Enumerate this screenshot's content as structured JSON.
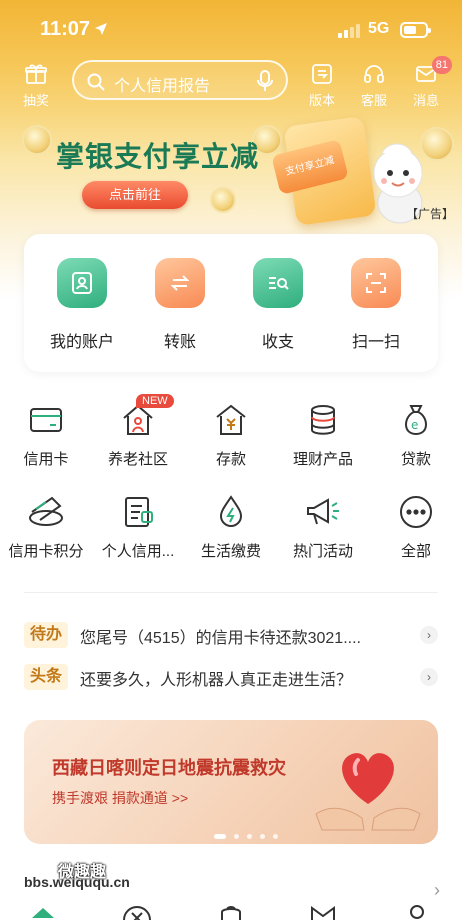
{
  "status_bar": {
    "time": "11:07",
    "network": "5G"
  },
  "header": {
    "left_button": {
      "label": "抽奖",
      "icon": "gift-icon"
    },
    "search_placeholder": "个人信用报告",
    "right_buttons": [
      {
        "label": "版本",
        "icon": "version-icon"
      },
      {
        "label": "客服",
        "icon": "headset-icon"
      },
      {
        "label": "消息",
        "icon": "mail-icon",
        "badge": "81"
      }
    ]
  },
  "banner": {
    "title": "掌银支付享立减",
    "button_label": "点击前往",
    "card_text": "支付享立减",
    "ad_label": "【广告】"
  },
  "quick_actions": [
    {
      "label": "我的账户",
      "icon": "account-icon",
      "color": "#2fae7e"
    },
    {
      "label": "转账",
      "icon": "transfer-icon",
      "color": "#f88a54"
    },
    {
      "label": "收支",
      "icon": "ledger-search-icon",
      "color": "#2fae7e"
    },
    {
      "label": "扫一扫",
      "icon": "scan-icon",
      "color": "#f88a54"
    }
  ],
  "services": [
    {
      "label": "信用卡",
      "icon": "credit-card-icon"
    },
    {
      "label": "养老社区",
      "icon": "elderly-community-icon",
      "tag": "NEW"
    },
    {
      "label": "存款",
      "icon": "deposit-icon"
    },
    {
      "label": "理财产品",
      "icon": "wealth-products-icon"
    },
    {
      "label": "贷款",
      "icon": "loan-icon"
    },
    {
      "label": "信用卡积分",
      "icon": "card-points-icon"
    },
    {
      "label": "个人信用...",
      "icon": "credit-report-icon"
    },
    {
      "label": "生活缴费",
      "icon": "utility-payment-icon"
    },
    {
      "label": "热门活动",
      "icon": "megaphone-icon"
    },
    {
      "label": "全部",
      "icon": "more-icon"
    }
  ],
  "news": [
    {
      "tag": "待办",
      "text": "您尾号（4515）的信用卡待还款3021...."
    },
    {
      "tag": "头条",
      "text": "还要多久，人形机器人真正走进生活？"
    }
  ],
  "promo": {
    "title": "西藏日喀则定日地震抗震救灾",
    "subtitle": "携手渡艰 捐款通道 >>"
  },
  "watermark": {
    "line1": "微趣趣",
    "line2": "bbs.weiququ.cn"
  },
  "colors": {
    "brand_green": "#1a7a55",
    "accent_orange": "#f88a54",
    "header_yellow": "#f2b536",
    "badge_red": "#f4766f"
  }
}
